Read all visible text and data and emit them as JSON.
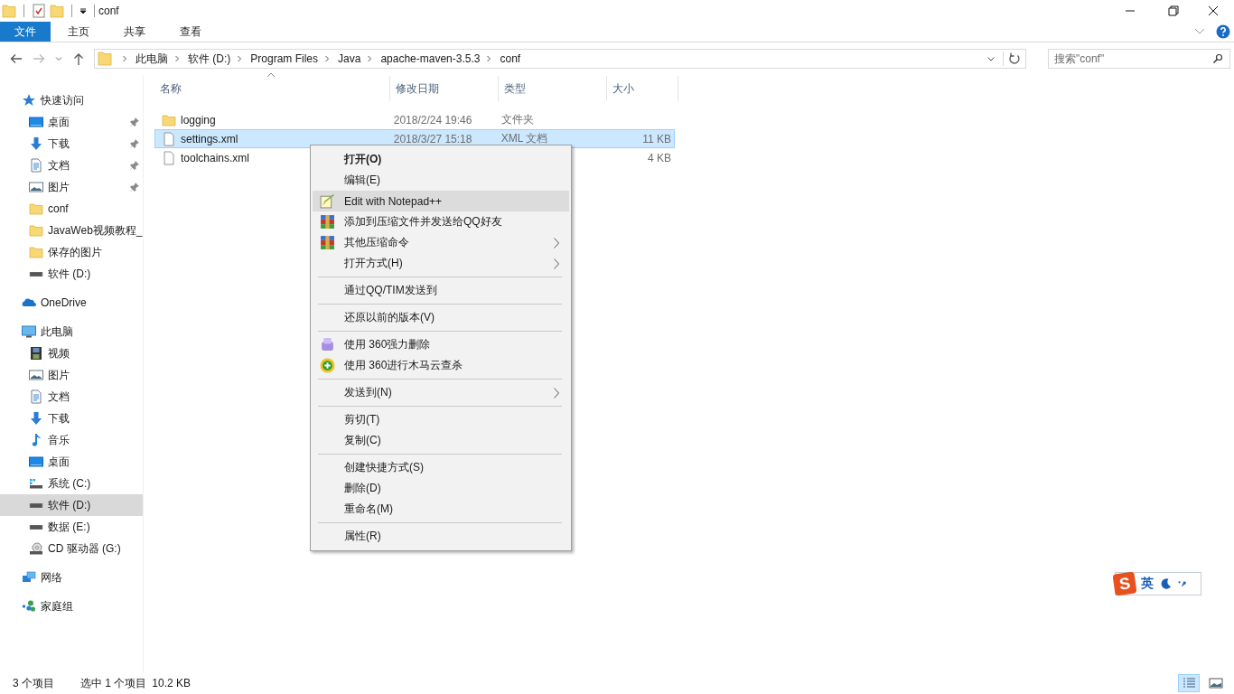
{
  "window": {
    "title": "conf",
    "quick_toolbar": [
      {
        "kind": "folder"
      },
      {
        "kind": "properties"
      },
      {
        "kind": "folder"
      },
      {
        "kind": "dropdown"
      }
    ]
  },
  "ribbon_tabs": [
    {
      "label": "文件",
      "kind": "file",
      "selected": false
    },
    {
      "label": "主页",
      "kind": "tab",
      "selected": false
    },
    {
      "label": "共享",
      "kind": "tab",
      "selected": false
    },
    {
      "label": "查看",
      "kind": "tab",
      "selected": false
    }
  ],
  "address_bar": {
    "segments": [
      "此电脑",
      "软件 (D:)",
      "Program Files",
      "Java",
      "apache-maven-3.5.3",
      "conf"
    ]
  },
  "search": {
    "placeholder": "搜索\"conf\""
  },
  "sidebar": {
    "groups": [
      {
        "label": "快速访问",
        "kind": "star",
        "selected": false,
        "children": [
          {
            "label": "桌面",
            "kind": "desktop",
            "pinned": true,
            "selected": false
          },
          {
            "label": "下载",
            "kind": "download",
            "pinned": true,
            "selected": false
          },
          {
            "label": "文档",
            "kind": "document",
            "pinned": true,
            "selected": false
          },
          {
            "label": "图片",
            "kind": "pictures",
            "pinned": true,
            "selected": false
          },
          {
            "label": "conf",
            "kind": "folder",
            "pinned": false,
            "selected": false
          },
          {
            "label": "JavaWeb视频教程_",
            "kind": "folder",
            "pinned": false,
            "selected": false
          },
          {
            "label": "保存的图片",
            "kind": "folder",
            "pinned": false,
            "selected": false
          },
          {
            "label": "软件 (D:)",
            "kind": "drive",
            "pinned": false,
            "selected": false
          }
        ]
      },
      {
        "label": "OneDrive",
        "kind": "cloud",
        "selected": false
      },
      {
        "label": "此电脑",
        "kind": "pc",
        "selected": false,
        "children": [
          {
            "label": "视频",
            "kind": "video",
            "pinned": false,
            "selected": false
          },
          {
            "label": "图片",
            "kind": "pictures",
            "pinned": false,
            "selected": false
          },
          {
            "label": "文档",
            "kind": "document",
            "pinned": false,
            "selected": false
          },
          {
            "label": "下载",
            "kind": "download",
            "pinned": false,
            "selected": false
          },
          {
            "label": "音乐",
            "kind": "music",
            "pinned": false,
            "selected": false
          },
          {
            "label": "桌面",
            "kind": "desktop",
            "pinned": false,
            "selected": false
          },
          {
            "label": "系统 (C:)",
            "kind": "system-drive",
            "pinned": false,
            "selected": false
          },
          {
            "label": "软件 (D:)",
            "kind": "drive",
            "pinned": false,
            "selected": true
          },
          {
            "label": "数据 (E:)",
            "kind": "drive",
            "pinned": false,
            "selected": false
          },
          {
            "label": "CD 驱动器 (G:)",
            "kind": "cd",
            "pinned": false,
            "selected": false
          }
        ]
      },
      {
        "label": "网络",
        "kind": "network",
        "selected": false
      },
      {
        "label": "家庭组",
        "kind": "homegroup",
        "selected": false
      }
    ]
  },
  "file_list": {
    "columns": [
      "名称",
      "修改日期",
      "类型",
      "大小"
    ],
    "rows": [
      {
        "name": "logging",
        "kind": "folder",
        "modified": "2018/2/24 19:46",
        "type": "文件夹",
        "size": "",
        "selected": false
      },
      {
        "name": "settings.xml",
        "kind": "file",
        "modified": "2018/3/27 15:18",
        "type": "XML 文档",
        "size": "11 KB",
        "selected": true
      },
      {
        "name": "toolchains.xml",
        "kind": "file",
        "modified": "",
        "type": "",
        "size": "4 KB",
        "selected": false
      }
    ]
  },
  "context_menu": {
    "items": [
      {
        "kind": "plain",
        "label": "打开(O)",
        "bold": true,
        "submenu": false,
        "selected": false
      },
      {
        "kind": "plain",
        "label": "编辑(E)",
        "bold": false,
        "submenu": false,
        "selected": false
      },
      {
        "kind": "notepad",
        "label": "Edit with Notepad++",
        "bold": false,
        "submenu": false,
        "selected": true
      },
      {
        "kind": "archive",
        "label": "添加到压缩文件并发送给QQ好友",
        "bold": false,
        "submenu": false,
        "selected": false
      },
      {
        "kind": "archive",
        "label": "其他压缩命令",
        "bold": false,
        "submenu": true,
        "selected": false
      },
      {
        "kind": "plain",
        "label": "打开方式(H)",
        "bold": false,
        "submenu": true,
        "selected": false
      },
      {
        "kind": "separator"
      },
      {
        "kind": "plain",
        "label": "通过QQ/TIM发送到",
        "bold": false,
        "submenu": false,
        "selected": false
      },
      {
        "kind": "separator"
      },
      {
        "kind": "plain",
        "label": "还原以前的版本(V)",
        "bold": false,
        "submenu": false,
        "selected": false
      },
      {
        "kind": "separator"
      },
      {
        "kind": "shredder",
        "label": "使用 360强力删除",
        "bold": false,
        "submenu": false,
        "selected": false
      },
      {
        "kind": "shield",
        "label": "使用 360进行木马云查杀",
        "bold": false,
        "submenu": false,
        "selected": false
      },
      {
        "kind": "separator"
      },
      {
        "kind": "plain",
        "label": "发送到(N)",
        "bold": false,
        "submenu": true,
        "selected": false
      },
      {
        "kind": "separator"
      },
      {
        "kind": "plain",
        "label": "剪切(T)",
        "bold": false,
        "submenu": false,
        "selected": false
      },
      {
        "kind": "plain",
        "label": "复制(C)",
        "bold": false,
        "submenu": false,
        "selected": false
      },
      {
        "kind": "separator"
      },
      {
        "kind": "plain",
        "label": "创建快捷方式(S)",
        "bold": false,
        "submenu": false,
        "selected": false
      },
      {
        "kind": "plain",
        "label": "删除(D)",
        "bold": false,
        "submenu": false,
        "selected": false
      },
      {
        "kind": "plain",
        "label": "重命名(M)",
        "bold": false,
        "submenu": false,
        "selected": false
      },
      {
        "kind": "separator"
      },
      {
        "kind": "plain",
        "label": "属性(R)",
        "bold": false,
        "submenu": false,
        "selected": false
      }
    ]
  },
  "ime_bar": {
    "logo": "S",
    "mode": "英"
  },
  "status_bar": {
    "item_count": "3 个项目",
    "selection": "选中 1 个项目",
    "selection_size": "10.2 KB",
    "views": [
      {
        "kind": "details",
        "selected": true
      },
      {
        "kind": "large-icons",
        "selected": false
      }
    ]
  }
}
